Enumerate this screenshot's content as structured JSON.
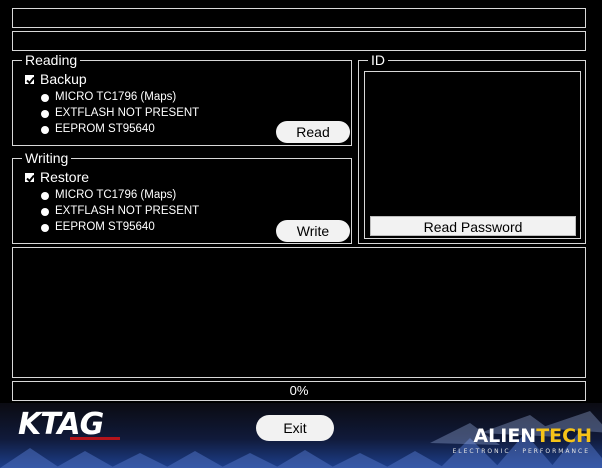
{
  "reading": {
    "title": "Reading",
    "backup_label": "Backup",
    "backup_checked": true,
    "options": [
      "MICRO TC1796 (Maps)",
      "EXTFLASH NOT PRESENT",
      "EEPROM ST95640"
    ],
    "read_button": "Read"
  },
  "writing": {
    "title": "Writing",
    "restore_label": "Restore",
    "restore_checked": true,
    "options": [
      "MICRO TC1796 (Maps)",
      "EXTFLASH NOT PRESENT",
      "EEPROM ST95640"
    ],
    "write_button": "Write"
  },
  "id_panel": {
    "title": "ID",
    "read_password_button": "Read Password"
  },
  "progress": {
    "text": "0%",
    "value": 0
  },
  "footer": {
    "exit_button": "Exit",
    "logo_left": "KTAG",
    "logo_right_a": "ALIEN",
    "logo_right_b": "TECH",
    "logo_right_sub": "ELECTRONIC · PERFORMANCE"
  },
  "colors": {
    "background": "#000000",
    "border": "#d8d8d8",
    "button": "#f2f2f2",
    "brand_blue": "#1d3f8c",
    "brand_yellow": "#f6c318"
  }
}
